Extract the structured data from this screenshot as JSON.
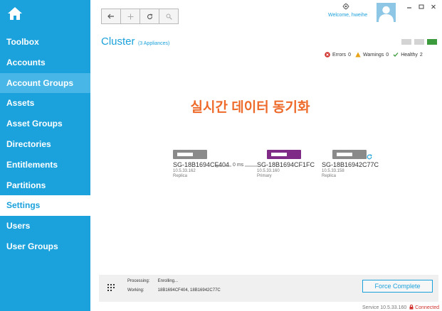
{
  "sidebar": {
    "items": [
      {
        "label": "Toolbox"
      },
      {
        "label": "Accounts"
      },
      {
        "label": "Account Groups"
      },
      {
        "label": "Assets"
      },
      {
        "label": "Asset Groups"
      },
      {
        "label": "Directories"
      },
      {
        "label": "Entitlements"
      },
      {
        "label": "Partitions"
      },
      {
        "label": "Settings"
      },
      {
        "label": "Users"
      },
      {
        "label": "User Groups"
      }
    ],
    "active": "Settings",
    "hover": "Account Groups"
  },
  "header": {
    "welcome": "Welcome, hweihe"
  },
  "page": {
    "title": "Cluster",
    "subtitle": "(3 Appliances)"
  },
  "health": {
    "errors_label": "Errors",
    "errors_count": "0",
    "warnings_label": "Warnings",
    "warnings_count": "0",
    "healthy_label": "Healthy",
    "healthy_count": "2"
  },
  "overlay_title": "실시간 데이터 동기화",
  "appliances": [
    {
      "name": "SG-18B1694CF404",
      "ip": "10.5.33.162",
      "role": "Replica",
      "color": "#8a8a8a"
    },
    {
      "name": "SG-18B1694CF1FC",
      "ip": "10.5.33.160",
      "role": "Primary",
      "color": "#7e2a86"
    },
    {
      "name": "SG-18B16942C77C",
      "ip": "10.5.33.158",
      "role": "Replica",
      "color": "#8a8a8a"
    }
  ],
  "latency": "0 ms",
  "processing": {
    "processing_label": "Processing:",
    "processing_value": "Enrolling...",
    "working_label": "Working:",
    "working_value": "18B1694CF404, 18B16942C77C",
    "force_button": "Force Complete"
  },
  "status": {
    "service": "Service 10.5.33.160",
    "connection": "Connected"
  },
  "colors": {
    "accent": "#1ba1db",
    "primary_appliance": "#7e2a86",
    "replica_appliance": "#8a8a8a",
    "overlay": "#ee6a2a",
    "healthy": "#3b9a3b",
    "error": "#d0312d",
    "warning": "#e8a317"
  }
}
